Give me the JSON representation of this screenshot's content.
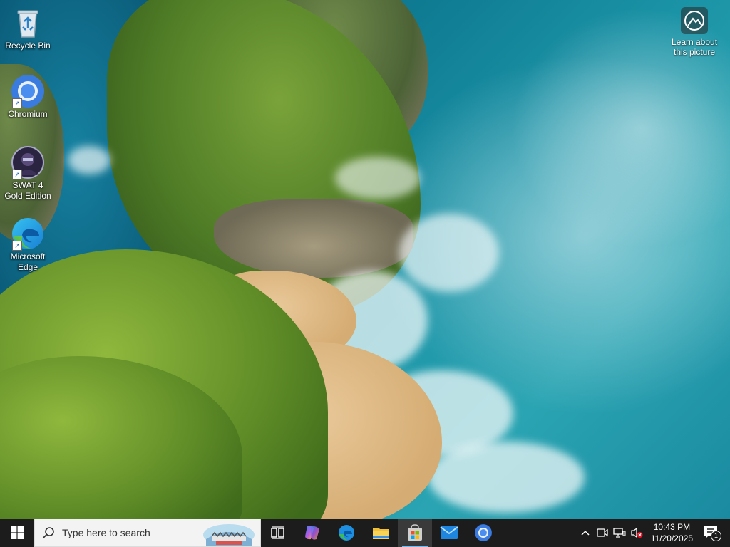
{
  "desktop": {
    "icons": [
      {
        "label": "Recycle Bin",
        "icon": "recycle-bin-icon"
      },
      {
        "label": "Chromium",
        "icon": "chromium-icon"
      },
      {
        "label": "SWAT 4 Gold Edition",
        "icon": "swat4-icon"
      },
      {
        "label": "Microsoft Edge",
        "icon": "edge-icon"
      }
    ],
    "learn_about": {
      "label_line1": "Learn about",
      "label_line2": "this picture",
      "icon": "camera-icon"
    }
  },
  "taskbar": {
    "start_icon": "windows-logo-icon",
    "search": {
      "placeholder": "Type here to search",
      "icon": "search-icon"
    },
    "apps": [
      {
        "name": "Task View",
        "icon": "task-view-icon"
      },
      {
        "name": "Copilot",
        "icon": "copilot-icon"
      },
      {
        "name": "Microsoft Edge",
        "icon": "edge-icon"
      },
      {
        "name": "File Explorer",
        "icon": "folder-icon"
      },
      {
        "name": "Microsoft Store",
        "icon": "store-icon",
        "active": true
      },
      {
        "name": "Mail",
        "icon": "mail-icon"
      },
      {
        "name": "Chromium",
        "icon": "chromium-icon"
      }
    ],
    "tray": {
      "icons": [
        "chevron-up-icon",
        "meet-now-icon",
        "network-icon",
        "volume-muted-icon"
      ],
      "time": "10:43 PM",
      "date": "11/20/2025",
      "notification_count": "1"
    }
  },
  "colors": {
    "taskbar_bg": "#1c1c1c",
    "accent": "#76b9ed"
  }
}
